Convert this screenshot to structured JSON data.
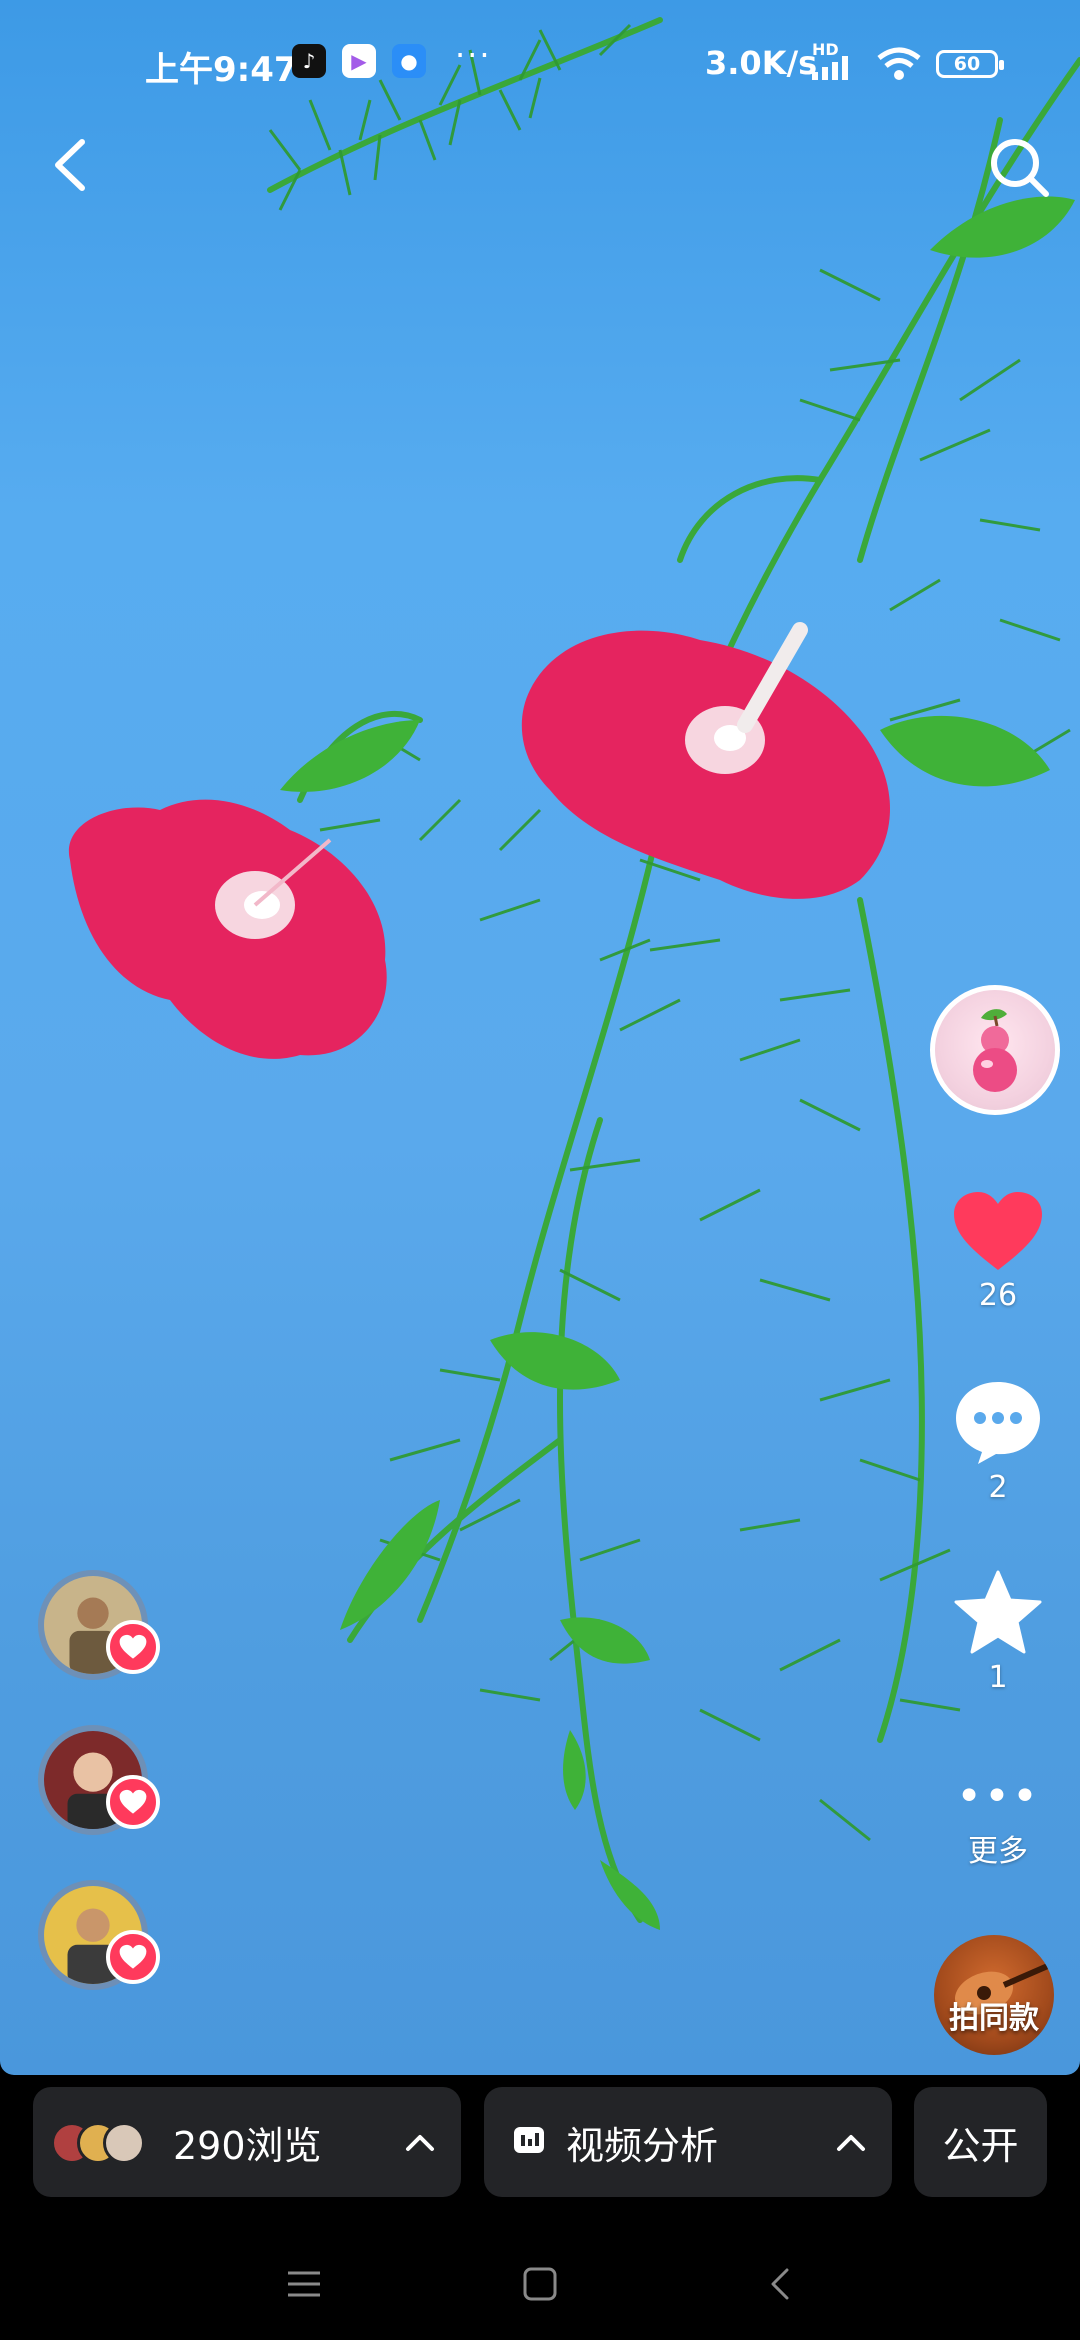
{
  "status_bar": {
    "time": "上午9:47",
    "more": "···",
    "network_speed": "3.0K/s",
    "hd_badge": "HD",
    "battery": "60"
  },
  "nav": {
    "back_icon": "chevron-left-icon",
    "search_icon": "search-icon"
  },
  "actions": {
    "like_count": "26",
    "comment_count": "2",
    "favorite_count": "1",
    "more_dots": "•••",
    "more_label": "更多",
    "remix_label": "拍同款"
  },
  "colors": {
    "like": "#ff3a5c",
    "sky": "#57acf0",
    "flower": "#e5245f",
    "leaf": "#3fb238"
  },
  "bottom_bar": {
    "views_label": "290浏览",
    "analysis_label": "视频分析",
    "public_label": "公开",
    "chevron": "^"
  },
  "system_nav": {
    "menu": "≡",
    "home": "□",
    "back": "‹"
  }
}
